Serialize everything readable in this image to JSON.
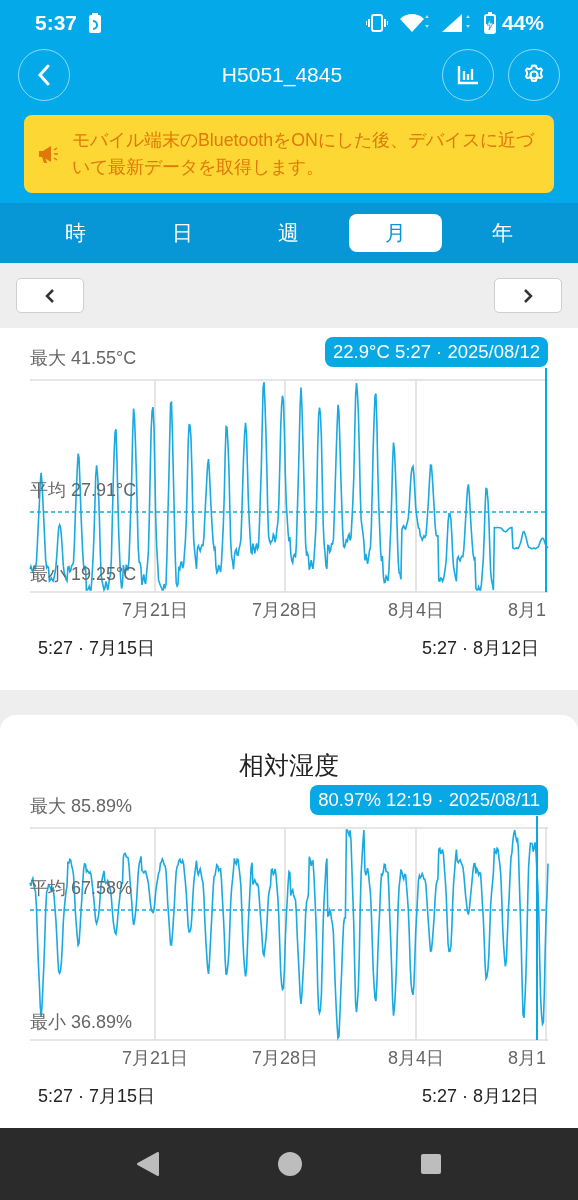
{
  "status_bar": {
    "time": "5:37",
    "battery": "44%"
  },
  "header": {
    "title": "H5051_4845"
  },
  "notice": {
    "text": "モバイル端末のBluetoothをONにした後、デバイスに近づいて最新データを取得します。"
  },
  "tabs": [
    {
      "label": "時",
      "selected": false
    },
    {
      "label": "日",
      "selected": false
    },
    {
      "label": "週",
      "selected": false
    },
    {
      "label": "月",
      "selected": true
    },
    {
      "label": "年",
      "selected": false
    }
  ],
  "charts": [
    {
      "max_label": "最大 41.55°C",
      "avg_label": "平均 27.91°C",
      "min_label": "最小 19.25°C",
      "tooltip": "22.9°C 5:27 · 2025/08/12",
      "x_labels": [
        "7月21日",
        "7月28日",
        "8月4日",
        "8月1"
      ],
      "range_start": "5:27 · 7月15日",
      "range_end": "5:27 · 8月12日"
    },
    {
      "title": "相対湿度",
      "max_label": "最大 85.89%",
      "avg_label": "平均 67.58%",
      "min_label": "最小 36.89%",
      "tooltip": "80.97% 12:19 · 2025/08/11",
      "x_labels": [
        "7月21日",
        "7月28日",
        "8月4日",
        "8月1"
      ],
      "range_start": "5:27 · 7月15日",
      "range_end": "5:27 · 8月12日"
    }
  ]
}
